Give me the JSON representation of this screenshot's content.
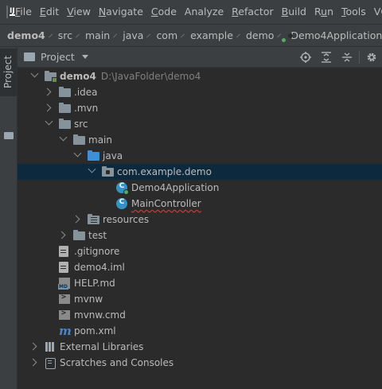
{
  "menubar": {
    "logo_letter": "IJ",
    "items": [
      {
        "label": "File",
        "mnemonic": "F"
      },
      {
        "label": "Edit",
        "mnemonic": "E"
      },
      {
        "label": "View",
        "mnemonic": "V"
      },
      {
        "label": "Navigate",
        "mnemonic": "N"
      },
      {
        "label": "Code",
        "mnemonic": "C"
      },
      {
        "label": "Analyze",
        "mnemonic": ""
      },
      {
        "label": "Refactor",
        "mnemonic": "R"
      },
      {
        "label": "Build",
        "mnemonic": "B"
      },
      {
        "label": "Run",
        "mnemonic": "u"
      },
      {
        "label": "Tools",
        "mnemonic": "T"
      },
      {
        "label": "VCS",
        "mnemonic": "S"
      }
    ]
  },
  "breadcrumbs": [
    "demo4",
    "src",
    "main",
    "java",
    "com",
    "example",
    "demo",
    "Demo4Application"
  ],
  "toolstrip": {
    "project_tab": "Project"
  },
  "panel": {
    "title": "Project",
    "tools": [
      "locate-icon",
      "expand-all-icon",
      "collapse-all-icon",
      "settings-icon"
    ]
  },
  "tree": [
    {
      "name": "demo4",
      "hint": "D:\\JavaFolder\\demo4",
      "level": 0,
      "arrow": "open",
      "icon": "module-folder-icon",
      "bold": true
    },
    {
      "name": ".idea",
      "level": 1,
      "arrow": "closed",
      "icon": "folder-icon"
    },
    {
      "name": ".mvn",
      "level": 1,
      "arrow": "closed",
      "icon": "folder-icon"
    },
    {
      "name": "src",
      "level": 1,
      "arrow": "open",
      "icon": "folder-icon"
    },
    {
      "name": "main",
      "level": 2,
      "arrow": "open",
      "icon": "folder-icon"
    },
    {
      "name": "java",
      "level": 3,
      "arrow": "open",
      "icon": "source-folder-icon"
    },
    {
      "name": "com.example.demo",
      "level": 4,
      "arrow": "open",
      "icon": "package-icon",
      "selected": true
    },
    {
      "name": "Demo4Application",
      "level": 5,
      "arrow": "none",
      "icon": "spring-boot-class-icon"
    },
    {
      "name": "MainController",
      "level": 5,
      "arrow": "none",
      "icon": "class-icon",
      "squiggle": true
    },
    {
      "name": "resources",
      "level": 3,
      "arrow": "closed",
      "icon": "resources-folder-icon"
    },
    {
      "name": "test",
      "level": 2,
      "arrow": "closed",
      "icon": "folder-icon"
    },
    {
      "name": ".gitignore",
      "level": 1,
      "arrow": "none",
      "icon": "gitignore-file-icon"
    },
    {
      "name": "demo4.iml",
      "level": 1,
      "arrow": "none",
      "icon": "iml-file-icon"
    },
    {
      "name": "HELP.md",
      "level": 1,
      "arrow": "none",
      "icon": "markdown-file-icon"
    },
    {
      "name": "mvnw",
      "level": 1,
      "arrow": "none",
      "icon": "shell-file-icon"
    },
    {
      "name": "mvnw.cmd",
      "level": 1,
      "arrow": "none",
      "icon": "shell-file-icon"
    },
    {
      "name": "pom.xml",
      "level": 1,
      "arrow": "none",
      "icon": "maven-icon"
    },
    {
      "name": "External Libraries",
      "level": 0,
      "arrow": "closed",
      "icon": "libraries-icon"
    },
    {
      "name": "Scratches and Consoles",
      "level": 0,
      "arrow": "closed",
      "icon": "scratches-icon"
    }
  ]
}
